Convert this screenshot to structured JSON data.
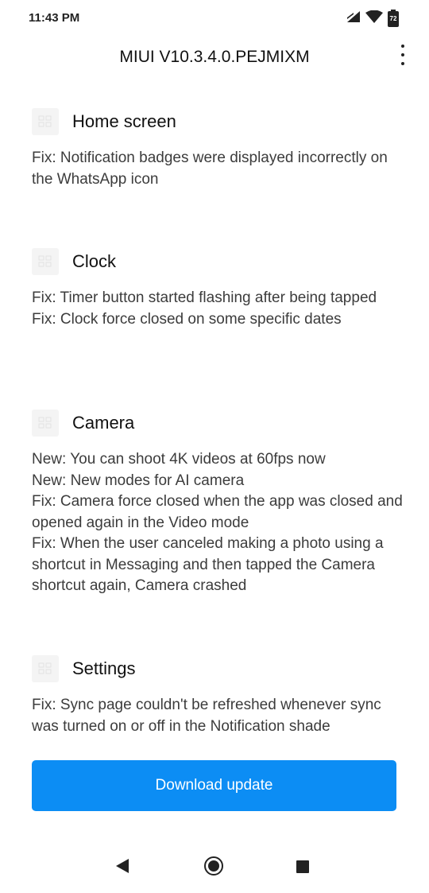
{
  "status_bar": {
    "time": "11:43 PM",
    "battery_level": "72",
    "icons": [
      "signal-icon",
      "wifi-icon",
      "battery-icon"
    ]
  },
  "header": {
    "title": "MIUI V10.3.4.0.PEJMIXM",
    "more_icon": "more-vert-icon"
  },
  "sections": [
    {
      "name": "Home screen",
      "icon": "app-placeholder-icon",
      "notes": [
        "Fix: Notification badges were displayed incorrectly on the WhatsApp icon"
      ]
    },
    {
      "name": "Clock",
      "icon": "app-placeholder-icon",
      "notes": [
        "Fix: Timer button started flashing after being tapped",
        "Fix: Clock force closed on some specific dates"
      ]
    },
    {
      "name": "Camera",
      "icon": "app-placeholder-icon",
      "notes": [
        "New: You can shoot 4K videos at 60fps now",
        "New: New modes for AI camera",
        "Fix: Camera force closed when the app was closed and opened again in the Video mode",
        "Fix: When the user canceled making a photo using a shortcut in Messaging and then tapped the Camera shortcut again, Camera crashed"
      ]
    },
    {
      "name": "Settings",
      "icon": "app-placeholder-icon",
      "notes": [
        "Fix: Sync page couldn't be refreshed whenever sync was turned on or off in the Notification shade"
      ]
    }
  ],
  "download_button": {
    "label": "Download update",
    "color": "#0c8df4"
  },
  "nav_bar": {
    "icons": [
      "back-icon",
      "home-icon",
      "recents-icon"
    ]
  }
}
